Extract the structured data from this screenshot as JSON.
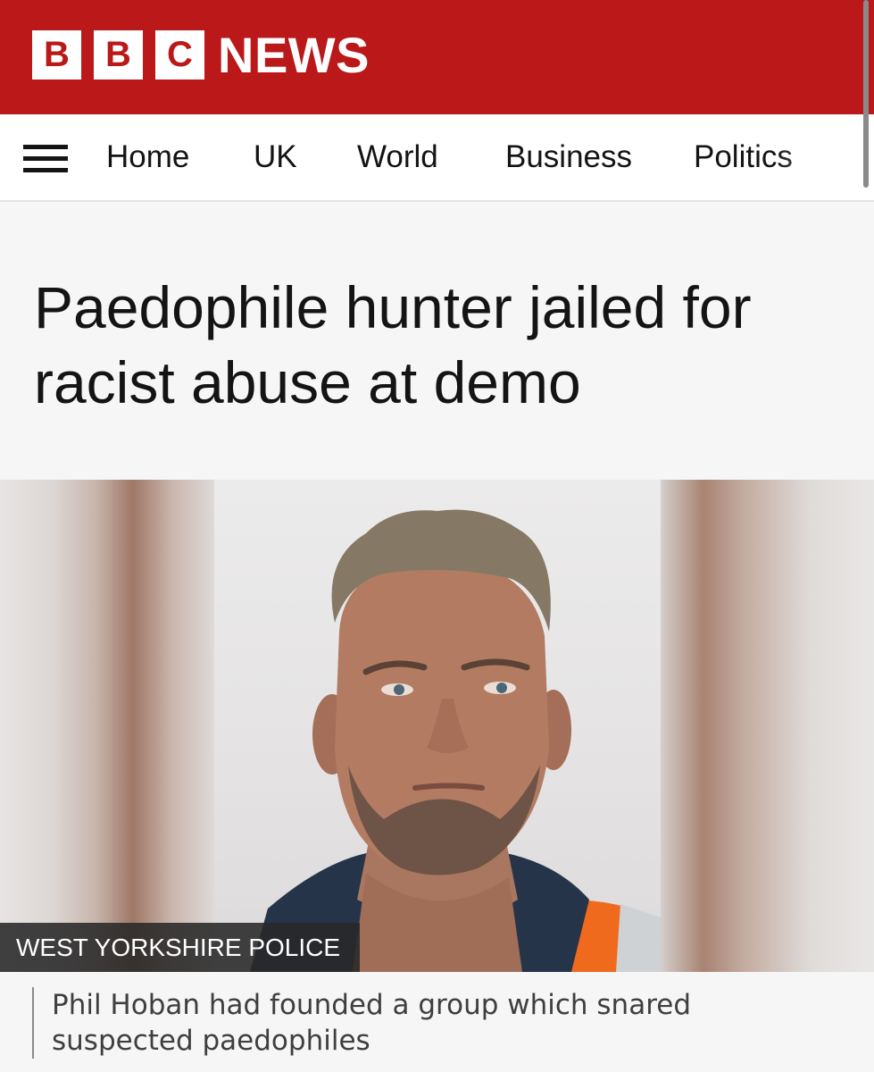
{
  "masthead": {
    "logo_letters": [
      "B",
      "B",
      "C"
    ],
    "logo_word": "NEWS",
    "background_color": "#bb1919"
  },
  "nav": {
    "menu_icon": "hamburger-menu-icon",
    "items": [
      "Home",
      "UK",
      "World",
      "Business",
      "Politics"
    ]
  },
  "article": {
    "headline": "Paedophile hunter jailed for racist abuse at demo",
    "image_credit": "WEST YORKSHIRE POLICE",
    "image_caption": "Phil Hoban had founded a group which snared suspected paedophiles"
  }
}
